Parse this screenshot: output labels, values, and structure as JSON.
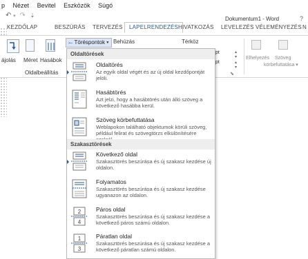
{
  "menubar": [
    "p",
    "Nézet",
    "Bevitel",
    "Eszközök",
    "Súgó"
  ],
  "qat": {
    "undo": "↶",
    "redo": "↷",
    "more": "⇣"
  },
  "title": "Dokumentum1 - Word",
  "help": "?",
  "tabs": [
    "KEZDŐLAP",
    "BESZÚRÁS",
    "TERVEZÉS",
    "LAPELRENDEZÉS",
    "HIVATKOZÁS",
    "LEVELEZÉS",
    "VÉLEMÉNYEZÉS",
    "N"
  ],
  "ribbon": {
    "btn_orient": "ájolás",
    "btn_size": "Méret",
    "btn_columns": "Hasábok",
    "breaks_button": "Töréspontok ▾",
    "line_numbers": "Behúzás",
    "spacing": "Térköz",
    "pt1": "pt",
    "pt2": "pt",
    "wrap_prev": "Elhelyezés",
    "wrap_text": "Szöveg",
    "wrap_text2": "körbefuttatása ▾",
    "group_label": "Oldalbeállítás",
    "group_launcher": "⬊"
  },
  "dropdown": {
    "section1": "Oldaltörések",
    "section2": "Szakasztörések",
    "items": [
      {
        "title": "Oldaltörés",
        "desc": "Az egyik oldal végét és az új oldal kezdőpontját jelöli."
      },
      {
        "title": "Hasábtörés",
        "desc": "Azt jelzi, hogy a hasábtörés után álló szöveg a következő hasábba kerül."
      },
      {
        "title": "Szöveg körbefuttatása",
        "desc": "Weblapokon található objektumok körüli szöveg, például felirat és szövegtörzs elkülönítésére szolgál."
      },
      {
        "title": "Következő oldal",
        "desc": "Szakasztörés beszúrása és új szakasz kezdése új oldalon."
      },
      {
        "title": "Folyamatos",
        "desc": "Szakasztörés beszúrása és új szakasz kezdése ugyanazon az oldalon."
      },
      {
        "title": "Páros oldal",
        "desc": "Szakasztörés beszúrása és új szakasz kezdése a következő páros számú oldalon."
      },
      {
        "title": "Páratlan oldal",
        "desc": "Szakasztörés beszúrása és új szakasz kezdése a következő páratlan számú oldalon."
      }
    ],
    "icon_labels": {
      "even": "2",
      "even2": "4",
      "odd": "1",
      "odd2": "3"
    }
  },
  "colors": {
    "accent": "#2b579a",
    "section_bg": "#eeeeee"
  }
}
